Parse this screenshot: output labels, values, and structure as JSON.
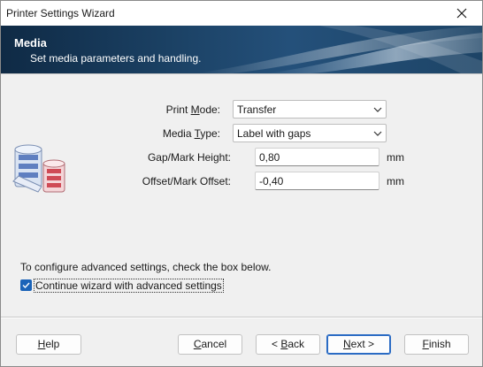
{
  "window": {
    "title": "Printer Settings Wizard",
    "close_icon": "close-icon"
  },
  "banner": {
    "title": "Media",
    "subtitle": "Set media parameters and handling."
  },
  "form": {
    "print_mode": {
      "label_pre": "Print ",
      "label_mnemonic": "M",
      "label_post": "ode:",
      "value": "Transfer"
    },
    "media_type": {
      "label_pre": "Media ",
      "label_mnemonic": "T",
      "label_post": "ype:",
      "value": "Label with gaps"
    },
    "gap_height": {
      "label": "Gap/Mark Height:",
      "value": "0,80",
      "unit": "mm"
    },
    "offset": {
      "label": "Offset/Mark Offset:",
      "value": "-0,40",
      "unit": "mm"
    }
  },
  "advanced": {
    "info": "To configure advanced settings, check the box below.",
    "checkbox_label": "Continue wizard with advanced settings",
    "checked": true
  },
  "buttons": {
    "help": {
      "mnemonic": "H",
      "rest": "elp"
    },
    "cancel": {
      "mnemonic": "C",
      "rest": "ancel"
    },
    "back": {
      "pre": "< ",
      "mnemonic": "B",
      "rest": "ack"
    },
    "next": {
      "mnemonic": "N",
      "rest": "ext >"
    },
    "finish": {
      "mnemonic": "F",
      "rest": "inish"
    }
  },
  "colors": {
    "accent": "#1b63b8",
    "banner_dark": "#0f2a45"
  }
}
